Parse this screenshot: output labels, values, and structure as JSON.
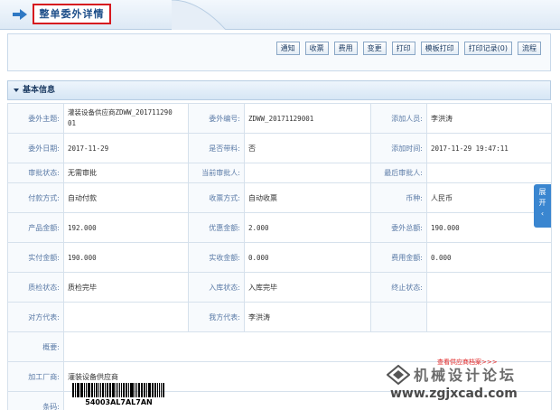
{
  "header": {
    "title": "整单委外详情"
  },
  "toolbar": {
    "buttons": [
      "通知",
      "收票",
      "费用",
      "变更",
      "打印",
      "模板打印",
      "打印记录(0)",
      "流程"
    ]
  },
  "section": {
    "title": "基本信息"
  },
  "fields": {
    "outsource_subject_label": "委外主题:",
    "outsource_subject_line1": "灌装设备供应商ZDWW_201711290",
    "outsource_subject_line2": "01",
    "outsource_no_label": "委外编号:",
    "outsource_no": "ZDWW_20171129001",
    "adder_label": "添加人员:",
    "adder": "李洪涛",
    "outsource_date_label": "委外日期:",
    "outsource_date": "2017-11-29",
    "with_material_label": "是否带料:",
    "with_material": "否",
    "add_time_label": "添加时间:",
    "add_time": "2017-11-29 19:47:11",
    "approval_status_label": "审批状态:",
    "approval_status": "无需审批",
    "current_approver_label": "当前审批人:",
    "current_approver": "",
    "last_approver_label": "最后审批人:",
    "last_approver": "",
    "payment_method_label": "付款方式:",
    "payment_method": "自动付款",
    "receipt_method_label": "收票方式:",
    "receipt_method": "自动收票",
    "currency_label": "币种:",
    "currency": "人民币",
    "product_amount_label": "产品金额:",
    "product_amount": "192.000",
    "discount_amount_label": "优惠金额:",
    "discount_amount": "2.000",
    "outsource_total_label": "委外总额:",
    "outsource_total": "190.000",
    "actual_paid_label": "实付金额:",
    "actual_paid": "190.000",
    "actual_received_label": "实收金额:",
    "actual_received": "0.000",
    "expense_amount_label": "费用金额:",
    "expense_amount": "0.000",
    "qc_status_label": "质检状态:",
    "qc_status": "质检完毕",
    "stock_in_status_label": "入库状态:",
    "stock_in_status": "入库完毕",
    "terminate_status_label": "终止状态:",
    "terminate_status": "",
    "counterpart_rep_label": "对方代表:",
    "counterpart_rep": "",
    "our_rep_label": "我方代表:",
    "our_rep": "李洪涛",
    "summary_label": "概要:",
    "summary": "",
    "processor_label": "加工厂商:",
    "processor": "灌装设备供应商",
    "barcode_label": "条码:",
    "barcode_text": "54003AL7AL7AN"
  },
  "side_tab": {
    "chars": [
      "展",
      "开",
      "‹"
    ]
  },
  "processor_link": "查看供应商档案>>>",
  "watermark": {
    "cn": "机械设计论坛",
    "url": "www.zgjxcad.com"
  },
  "colors": {
    "accent": "#3a86d0",
    "title_border": "#d6191f",
    "label": "#5a7aa6"
  }
}
